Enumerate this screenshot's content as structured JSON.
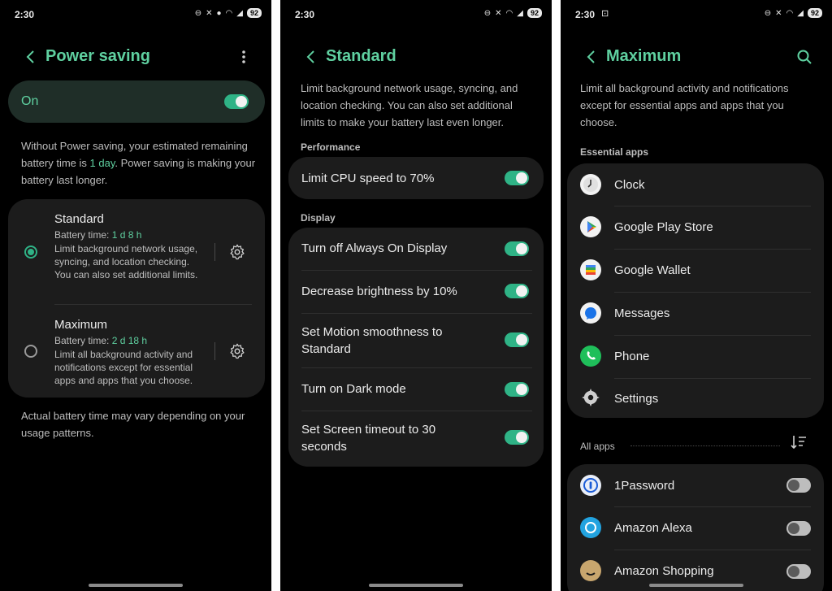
{
  "status": {
    "panel1_time": "2:30",
    "panel2_time": "2:30",
    "panel3_time": "2:30",
    "battery": "92"
  },
  "panel1": {
    "title": "Power saving",
    "toggle_label": "On",
    "toggle_on": true,
    "estimate_pre": "Without Power saving, your estimated remaining battery time is ",
    "estimate_value": "1 day",
    "estimate_post": ". Power saving is making your battery last longer.",
    "options": [
      {
        "title": "Standard",
        "time_label": "Battery time: ",
        "time_value": "1 d 8 h",
        "desc": "Limit background network usage, syncing, and location checking. You can also set additional limits.",
        "selected": true
      },
      {
        "title": "Maximum",
        "time_label": "Battery time: ",
        "time_value": "2 d 18 h",
        "desc": "Limit all background activity and notifications except for essential apps and apps that you choose.",
        "selected": false
      }
    ],
    "footer": "Actual battery time may vary depending on your usage patterns."
  },
  "panel2": {
    "title": "Standard",
    "desc": "Limit background network usage, syncing, and location checking. You can also set additional limits to make your battery last even longer.",
    "performance_label": "Performance",
    "performance_items": [
      {
        "label": "Limit CPU speed to 70%",
        "on": true
      }
    ],
    "display_label": "Display",
    "display_items": [
      {
        "label": "Turn off Always On Display",
        "on": true
      },
      {
        "label": "Decrease brightness by 10%",
        "on": true
      },
      {
        "label": "Set Motion smoothness to Standard",
        "on": true
      },
      {
        "label": "Turn on Dark mode",
        "on": true
      },
      {
        "label": "Set Screen timeout to 30 seconds",
        "on": true
      }
    ]
  },
  "panel3": {
    "title": "Maximum",
    "desc": "Limit all background activity and notifications except for essential apps and apps that you choose.",
    "essential_label": "Essential apps",
    "essential_apps": [
      "Clock",
      "Google Play Store",
      "Google Wallet",
      "Messages",
      "Phone",
      "Settings"
    ],
    "all_apps_label": "All apps",
    "all_apps": [
      {
        "name": "1Password",
        "on": false
      },
      {
        "name": "Amazon Alexa",
        "on": false
      },
      {
        "name": "Amazon Shopping",
        "on": false
      }
    ]
  },
  "colors": {
    "accent": "#5fd0a0",
    "toggle_on": "#2fb386",
    "card": "#1c1c1c",
    "background": "#000000"
  },
  "icons": {
    "back": "chevron-left-icon",
    "more": "more-vertical-icon",
    "search": "search-icon",
    "gear": "gear-icon",
    "sort": "sort-icon"
  }
}
